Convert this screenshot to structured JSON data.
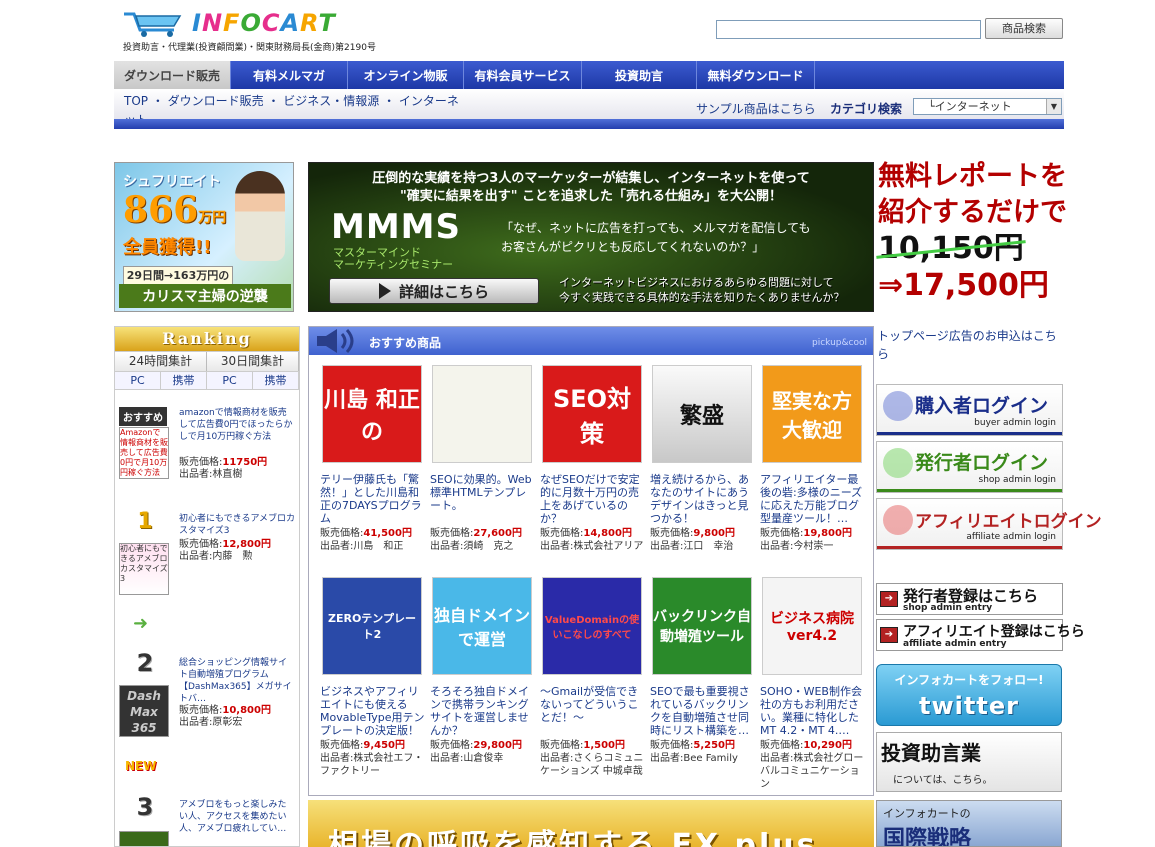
{
  "header": {
    "logo": "INFOCART",
    "license": "投資助言・代理業(投資顧問業)・関東財務局長(金商)第2190号",
    "search_value": "",
    "search_button": "商品検索"
  },
  "nav": [
    {
      "label": "ダウンロード販売",
      "active": true
    },
    {
      "label": "有料メルマガ"
    },
    {
      "label": "オンライン物販"
    },
    {
      "label": "有料会員サービス"
    },
    {
      "label": "投資助言"
    },
    {
      "label": "無料ダウンロード"
    }
  ],
  "breadcrumb": "TOP ・ ダウンロード販売 ・ ビジネス・情報源 ・ インターネット",
  "sample_link": "サンプル商品はこちら",
  "category": {
    "label": "カテゴリ検索",
    "selected": "└インターネット"
  },
  "banner_left": {
    "t1": "シュフリエイト",
    "amount": "866",
    "unit": "万円",
    "t3": "全員獲得!!",
    "t4": "29日間→163万円の衝撃!!",
    "t5": "カリスマ主婦の逆襲"
  },
  "banner_main": {
    "line1": "圧倒的な実績を持つ3人のマーケッターが結集し、インターネットを使って",
    "line2": "\"確実に結果を出す\" ことを追求した「売れる仕組み」を大公開！",
    "mmms": "MMMS",
    "sub1": "マスターマインド",
    "sub2": "マーケティングセミナー",
    "quote1": "「なぜ、ネットに広告を打っても、メルマガを配信しても",
    "quote2": "お客さんがピクリとも反応してくれないのか？」",
    "cta": "詳細はこちら",
    "foot1": "インターネットビジネスにおけるあらゆる問題に対して",
    "foot2": "今すぐ実践できる具体的な手法を知りたくありませんか？"
  },
  "banner_right": {
    "r1": "無料レポートを",
    "r1b": "紹介するだけで",
    "old_price": "10,150円",
    "new_price": "⇒17,500円"
  },
  "ranking": {
    "title": "Ranking",
    "tabs": [
      "24時間集計",
      "30日間集計"
    ],
    "subtabs": [
      "PC",
      "携帯",
      "PC",
      "携帯"
    ],
    "price_label": "販売価格:",
    "seller_label": "出品者:",
    "items": [
      {
        "badge": "おすすめ",
        "text": "amazonで情報商材を販売して広告費0円でほったらかしで月10万円稼ぐ方法",
        "price": "11750円",
        "seller": "林直樹",
        "thumb": "Amazonで情報商材を販売して広告費0円で月10万円稼ぐ方法"
      },
      {
        "badge": "1",
        "text": "初心者にもできるアメブロカスタマイズ3",
        "price": "12,800円",
        "seller": "内藤　勲",
        "thumb": "初心者にもできるアメブロカスタマイズ3"
      },
      {
        "badge": "2",
        "text": "総合ショッピング情報サイト自動増殖プログラム【DashMax365】メガサイトバ…",
        "price": "10,800円",
        "seller": "原彰宏",
        "thumb": "Dash Max 365"
      },
      {
        "badge": "3",
        "text": "アメブロをもっと楽しみたい人、アクセスを集めたい人、アメブロ疲れしてい…",
        "price": "",
        "seller": "",
        "thumb": ""
      }
    ],
    "new_badge": "NEW"
  },
  "rec": {
    "title": "おすすめ商品",
    "pickup": "pickup&cool",
    "price_label": "販売価格:",
    "seller_label": "出品者:",
    "products": [
      {
        "pic": "川島 和正の",
        "desc": "テリー伊藤氏も「驚然！」とした川島和正の7DAYSプログラム",
        "price": "41,500円",
        "seller": "川島　和正"
      },
      {
        "pic": "",
        "desc": "SEOに効果的。Web標準HTMLテンプレート。",
        "price": "27,600円",
        "seller": "須崎　克之"
      },
      {
        "pic": "SEO対策",
        "desc": "なぜSEOだけで安定的に月数十万円の売上をあげているのか？",
        "price": "14,800円",
        "seller": "株式会社アリア"
      },
      {
        "pic": "繁盛",
        "desc": "増え続けるから、あなたのサイトにあうデザインはきっと見つかる！",
        "price": "9,800円",
        "seller": "江口　幸治"
      },
      {
        "pic": "堅実な方大歓迎",
        "desc": "アフィリエイター最後の砦:多様のニーズに応えた万能ブログ型量産ツール！…",
        "price": "19,800円",
        "seller": "今村崇一"
      },
      {
        "pic": "ZEROテンプレート2",
        "desc": "ビジネスやアフィリエイトにも使えるMovableType用テンプレートの決定版！",
        "price": "9,450円",
        "seller": "株式会社エフ・ファクトリー"
      },
      {
        "pic": "独自ドメインで運営",
        "desc": "そろそろ独自ドメインで携帯ランキングサイトを運営しませんか？",
        "price": "29,800円",
        "seller": "山倉俊幸"
      },
      {
        "pic": "ValueDomainの使いこなしのすべて",
        "desc": "～Gmailが受信できないってどういうことだ！～",
        "price": "1,500円",
        "seller": "さくらコミュニケーションズ 中城卓哉"
      },
      {
        "pic": "バックリンク自動増殖ツール",
        "desc": "SEOで最も重要視されているバックリンクを自動増殖させ同時にリスト構築を…",
        "price": "5,250円",
        "seller": "Bee Family"
      },
      {
        "pic": "ビジネス病院 ver4.2",
        "desc": "SOHO・WEB制作会社の方もお利用ださい。業種に特化したMT 4.2・MT 4.…",
        "price": "10,290円",
        "seller": "株式会社グローバルコミュニケーション"
      }
    ]
  },
  "fx": "相場の呼吸を感知する FX plus",
  "right": {
    "ad_link": "トップページ広告のお申込はこちら",
    "logins": [
      {
        "title": "購入者ログイン",
        "sub": "buyer admin login",
        "color": "#1a2e8a"
      },
      {
        "title": "発行者ログイン",
        "sub": "shop admin login",
        "color": "#3a8a1a"
      },
      {
        "title": "アフィリエイトログイン",
        "sub": "affiliate admin login",
        "color": "#b32222"
      }
    ],
    "regs": [
      {
        "title": "発行者登録はこちら",
        "sub": "shop admin entry"
      },
      {
        "title": "アフィリエイト登録はこちら",
        "sub": "affiliate admin entry"
      }
    ],
    "twitter_t1": "インフォカートをフォロー!",
    "twitter_t2": "twitter",
    "advisory_t1": "投資助言業",
    "advisory_t2": "については、こちら。",
    "strategy_t1": "インフォカートの",
    "strategy_t2": "国際戦略"
  }
}
